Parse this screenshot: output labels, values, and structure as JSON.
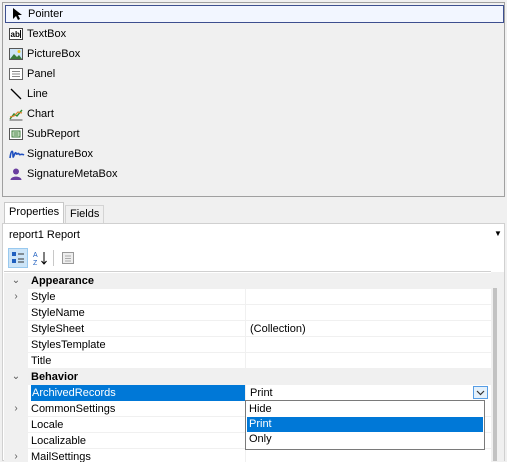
{
  "toolbox": {
    "items": [
      {
        "label": "Pointer",
        "icon": "pointer-icon"
      },
      {
        "label": "TextBox",
        "icon": "textbox-icon"
      },
      {
        "label": "PictureBox",
        "icon": "picturebox-icon"
      },
      {
        "label": "Panel",
        "icon": "panel-icon"
      },
      {
        "label": "Line",
        "icon": "line-icon"
      },
      {
        "label": "Chart",
        "icon": "chart-icon"
      },
      {
        "label": "SubReport",
        "icon": "subreport-icon"
      },
      {
        "label": "SignatureBox",
        "icon": "signaturebox-icon"
      },
      {
        "label": "SignatureMetaBox",
        "icon": "signaturemetabox-icon"
      }
    ],
    "selected": "Pointer"
  },
  "tabs": [
    {
      "label": "Properties",
      "active": true
    },
    {
      "label": "Fields",
      "active": false
    }
  ],
  "object_selector": {
    "value": "report1  Report"
  },
  "properties": {
    "categories": [
      {
        "label": "Appearance",
        "rows": [
          {
            "name": "Style",
            "value": "",
            "expandable": true
          },
          {
            "name": "StyleName",
            "value": ""
          },
          {
            "name": "StyleSheet",
            "value": "(Collection)"
          },
          {
            "name": "StylesTemplate",
            "value": ""
          },
          {
            "name": "Title",
            "value": ""
          }
        ]
      },
      {
        "label": "Behavior",
        "rows": [
          {
            "name": "ArchivedRecords",
            "value": "Print",
            "selected": true
          },
          {
            "name": "CommonSettings",
            "value": "",
            "expandable": true
          },
          {
            "name": "Locale",
            "value": ""
          },
          {
            "name": "Localizable",
            "value": ""
          },
          {
            "name": "MailSettings",
            "value": "",
            "expandable": true
          }
        ]
      }
    ]
  },
  "dropdown": {
    "options": [
      "Hide",
      "Print",
      "Only"
    ],
    "selected": "Print"
  },
  "colors": {
    "selection": "#0078d7",
    "background": "#f0f0f0",
    "toolbox_selected_border": "#3d4f8f"
  }
}
